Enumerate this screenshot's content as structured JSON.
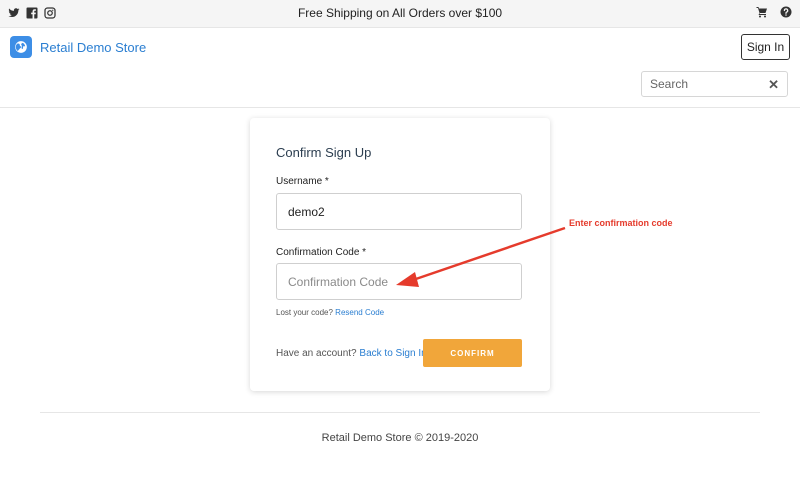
{
  "topbar": {
    "banner": "Free Shipping on All Orders over $100",
    "social_icons": [
      "twitter-icon",
      "facebook-icon",
      "instagram-icon"
    ],
    "right_icons": [
      "cart-icon",
      "help-icon"
    ]
  },
  "header": {
    "brand_name": "Retail Demo Store",
    "signin_label": "Sign In",
    "search_placeholder": "Search",
    "search_clear": "✕"
  },
  "form": {
    "title": "Confirm Sign Up",
    "username_label": "Username *",
    "username_value": "demo2",
    "code_label": "Confirmation Code *",
    "code_placeholder": "Confirmation Code",
    "lost_code_text": "Lost your code?",
    "resend_link": "Resend Code",
    "have_account_text": "Have an account?",
    "back_link": "Back to Sign In",
    "confirm_label": "CONFIRM"
  },
  "annotation": {
    "text": "Enter confirmation code",
    "color": "#e53b2c"
  },
  "footer": {
    "text": "Retail Demo Store © 2019-2020"
  },
  "colors": {
    "brand": "#2a7ed1",
    "confirm_button": "#f1a63a",
    "logo_bg": "#3d8ee6"
  }
}
